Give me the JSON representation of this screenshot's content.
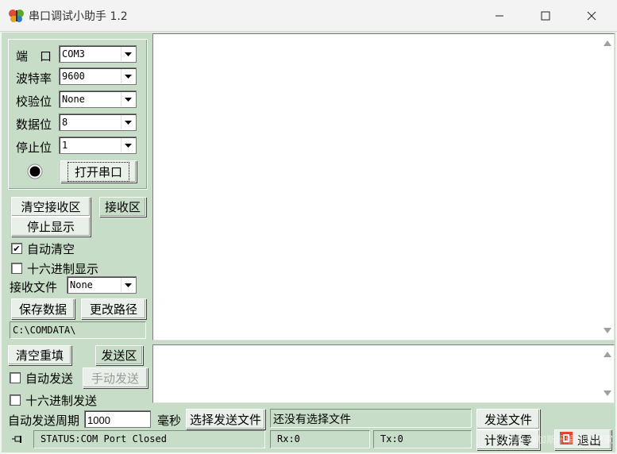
{
  "window": {
    "title": "串口调试小助手 1.2",
    "icons": {
      "app": "butterfly-icon",
      "minimize": "minimize-icon",
      "maximize": "maximize-icon",
      "close": "close-icon"
    }
  },
  "serial_settings": {
    "port_label": "端　口",
    "port_value": "COM3",
    "baud_label": "波特率",
    "baud_value": "9600",
    "parity_label": "校验位",
    "parity_value": "None",
    "databits_label": "数据位",
    "databits_value": "8",
    "stopbits_label": "停止位",
    "stopbits_value": "1",
    "open_button": "打开串口",
    "indicator_state": "off"
  },
  "receive_controls": {
    "clear_button": "清空接收区",
    "area_button": "接收区",
    "stop_button": "停止显示",
    "auto_clear_label": "自动清空",
    "auto_clear_checked": true,
    "hex_display_label": "十六进制显示",
    "hex_display_checked": false,
    "file_label": "接收文件",
    "file_value": "None",
    "save_button": "保存数据",
    "change_path_button": "更改路径",
    "path": "C:\\COMDATA\\"
  },
  "send_controls": {
    "clear_button": "清空重填",
    "area_button": "发送区",
    "auto_send_label": "自动发送",
    "auto_send_checked": false,
    "manual_send_button": "手动发送",
    "hex_send_label": "十六进制发送",
    "hex_send_checked": false,
    "period_label": "自动发送周期",
    "period_value": "1000",
    "ms_label": "毫秒",
    "choose_file_button": "选择发送文件",
    "file_status": "还没有选择文件",
    "send_file_button": "发送文件"
  },
  "status_bar": {
    "pin_icon": "pin-icon",
    "status": "STATUS:COM Port Closed",
    "rx": "Rx:0",
    "tx": "Tx:0",
    "count_clear_button": "计数清零",
    "exit_button": "退出",
    "exit_icon": "exit-icon"
  },
  "watermark": "CSDN @加斯乐编程梦想家",
  "colors": {
    "panel": "#c7ddc7",
    "textarea": "#ffffff",
    "titlebar": "#f3f3f3"
  }
}
